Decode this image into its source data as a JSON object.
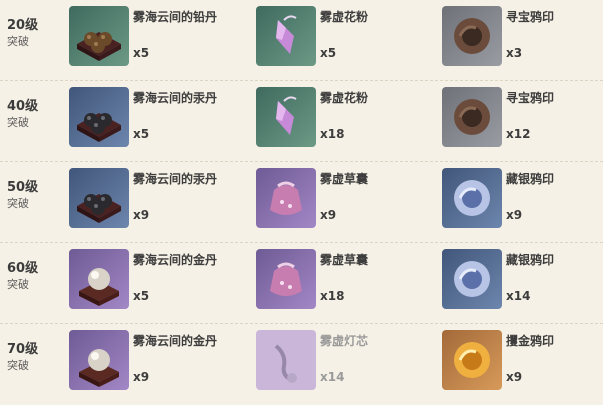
{
  "rows": [
    {
      "level": "20级",
      "stage": "突破",
      "materials": [
        {
          "name": "雾海云间的铅丹",
          "qty": "x5",
          "icon": "lead-pills-tray-icon"
        },
        {
          "name": "雾虚花粉",
          "qty": "x5",
          "icon": "mist-pollen-icon"
        },
        {
          "name": "寻宝鸦印",
          "qty": "x3",
          "icon": "treasure-crow-insignia-icon"
        }
      ]
    },
    {
      "level": "40级",
      "stage": "突破",
      "materials": [
        {
          "name": "雾海云间的汞丹",
          "qty": "x5",
          "icon": "mercury-pills-tray-icon"
        },
        {
          "name": "雾虚花粉",
          "qty": "x18",
          "icon": "mist-pollen-icon"
        },
        {
          "name": "寻宝鸦印",
          "qty": "x12",
          "icon": "treasure-crow-insignia-icon"
        }
      ]
    },
    {
      "level": "50级",
      "stage": "突破",
      "materials": [
        {
          "name": "雾海云间的汞丹",
          "qty": "x9",
          "icon": "mercury-pills-tray-icon"
        },
        {
          "name": "雾虚草囊",
          "qty": "x9",
          "icon": "mist-grass-pouch-icon"
        },
        {
          "name": "藏银鸦印",
          "qty": "x9",
          "icon": "silver-crow-insignia-icon"
        }
      ]
    },
    {
      "level": "60级",
      "stage": "突破",
      "materials": [
        {
          "name": "雾海云间的金丹",
          "qty": "x5",
          "icon": "gold-pill-stand-icon"
        },
        {
          "name": "雾虚草囊",
          "qty": "x18",
          "icon": "mist-grass-pouch-icon"
        },
        {
          "name": "藏银鸦印",
          "qty": "x14",
          "icon": "silver-crow-insignia-icon"
        }
      ]
    },
    {
      "level": "70级",
      "stage": "突破",
      "materials": [
        {
          "name": "雾海云间的金丹",
          "qty": "x9",
          "icon": "gold-pill-stand-icon"
        },
        {
          "name": "雾虚灯芯",
          "qty": "x14",
          "icon": "mist-wick-icon",
          "dim": true
        },
        {
          "name": "攫金鸦印",
          "qty": "x9",
          "icon": "golden-crow-insignia-icon"
        }
      ]
    }
  ]
}
